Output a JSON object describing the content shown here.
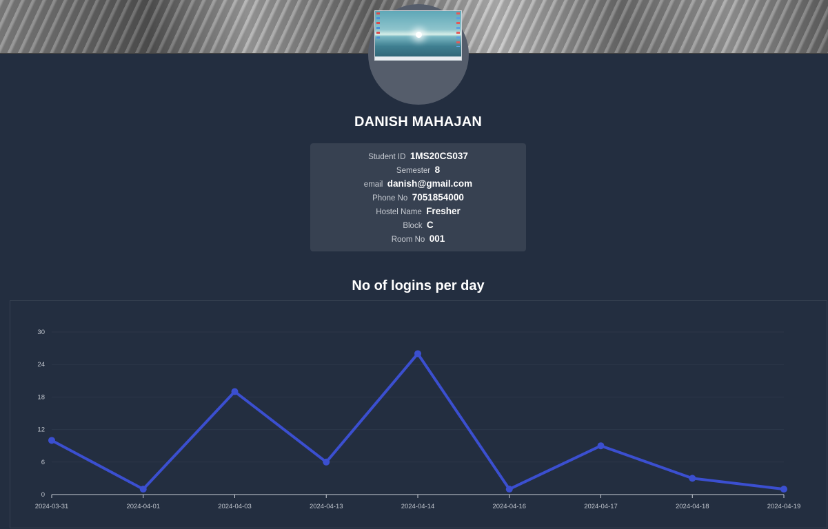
{
  "profile": {
    "name": "DANISH MAHAJAN",
    "fields": [
      {
        "label": "Student ID",
        "value": "1MS20CS037"
      },
      {
        "label": "Semester",
        "value": "8"
      },
      {
        "label": "email",
        "value": "danish@gmail.com"
      },
      {
        "label": "Phone No",
        "value": "7051854000"
      },
      {
        "label": "Hostel Name",
        "value": "Fresher"
      },
      {
        "label": "Block",
        "value": "C"
      },
      {
        "label": "Room No",
        "value": "001"
      }
    ]
  },
  "chart_data": {
    "type": "line",
    "title": "No of logins per day",
    "categories": [
      "2024-03-31",
      "2024-04-01",
      "2024-04-03",
      "2024-04-13",
      "2024-04-14",
      "2024-04-16",
      "2024-04-17",
      "2024-04-18",
      "2024-04-19"
    ],
    "values": [
      10,
      1,
      19,
      6,
      26,
      1,
      9,
      3,
      1
    ],
    "yticks": [
      0,
      6,
      12,
      18,
      24,
      30
    ],
    "ylim": [
      0,
      30
    ],
    "xlabel": "",
    "ylabel": "",
    "grid": true,
    "line_color": "#3b4fd0"
  }
}
